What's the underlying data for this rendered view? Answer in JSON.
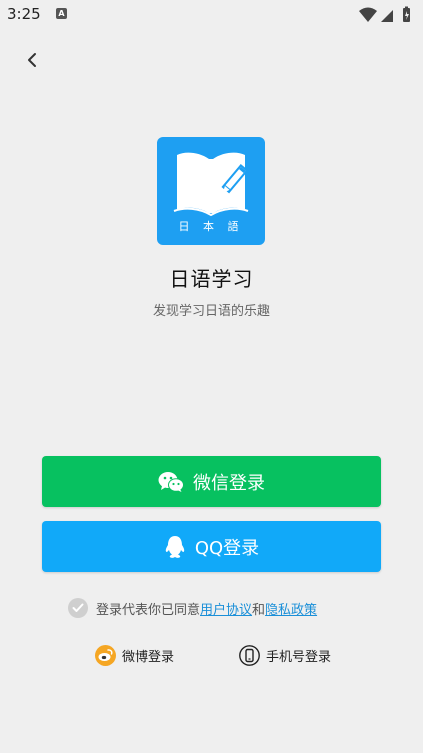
{
  "status_bar": {
    "time": "3:25",
    "notification_badge": "A"
  },
  "header": {
    "back_icon": "chevron-left-icon"
  },
  "app": {
    "logo_caption": "日 本 語",
    "name": "日语学习",
    "tagline": "发现学习日语的乐趣",
    "logo_color": "#1e9ff2"
  },
  "buttons": {
    "wechat_label": "微信登录",
    "wechat_color": "#07c160",
    "qq_label": "QQ登录",
    "qq_color": "#11a9f9"
  },
  "agreement": {
    "prefix": "登录代表你已同意",
    "terms_link": "用户协议",
    "joiner": "和",
    "privacy_link": "隐私政策",
    "checked": false
  },
  "alt_login": {
    "weibo_label": "微博登录",
    "phone_label": "手机号登录"
  }
}
